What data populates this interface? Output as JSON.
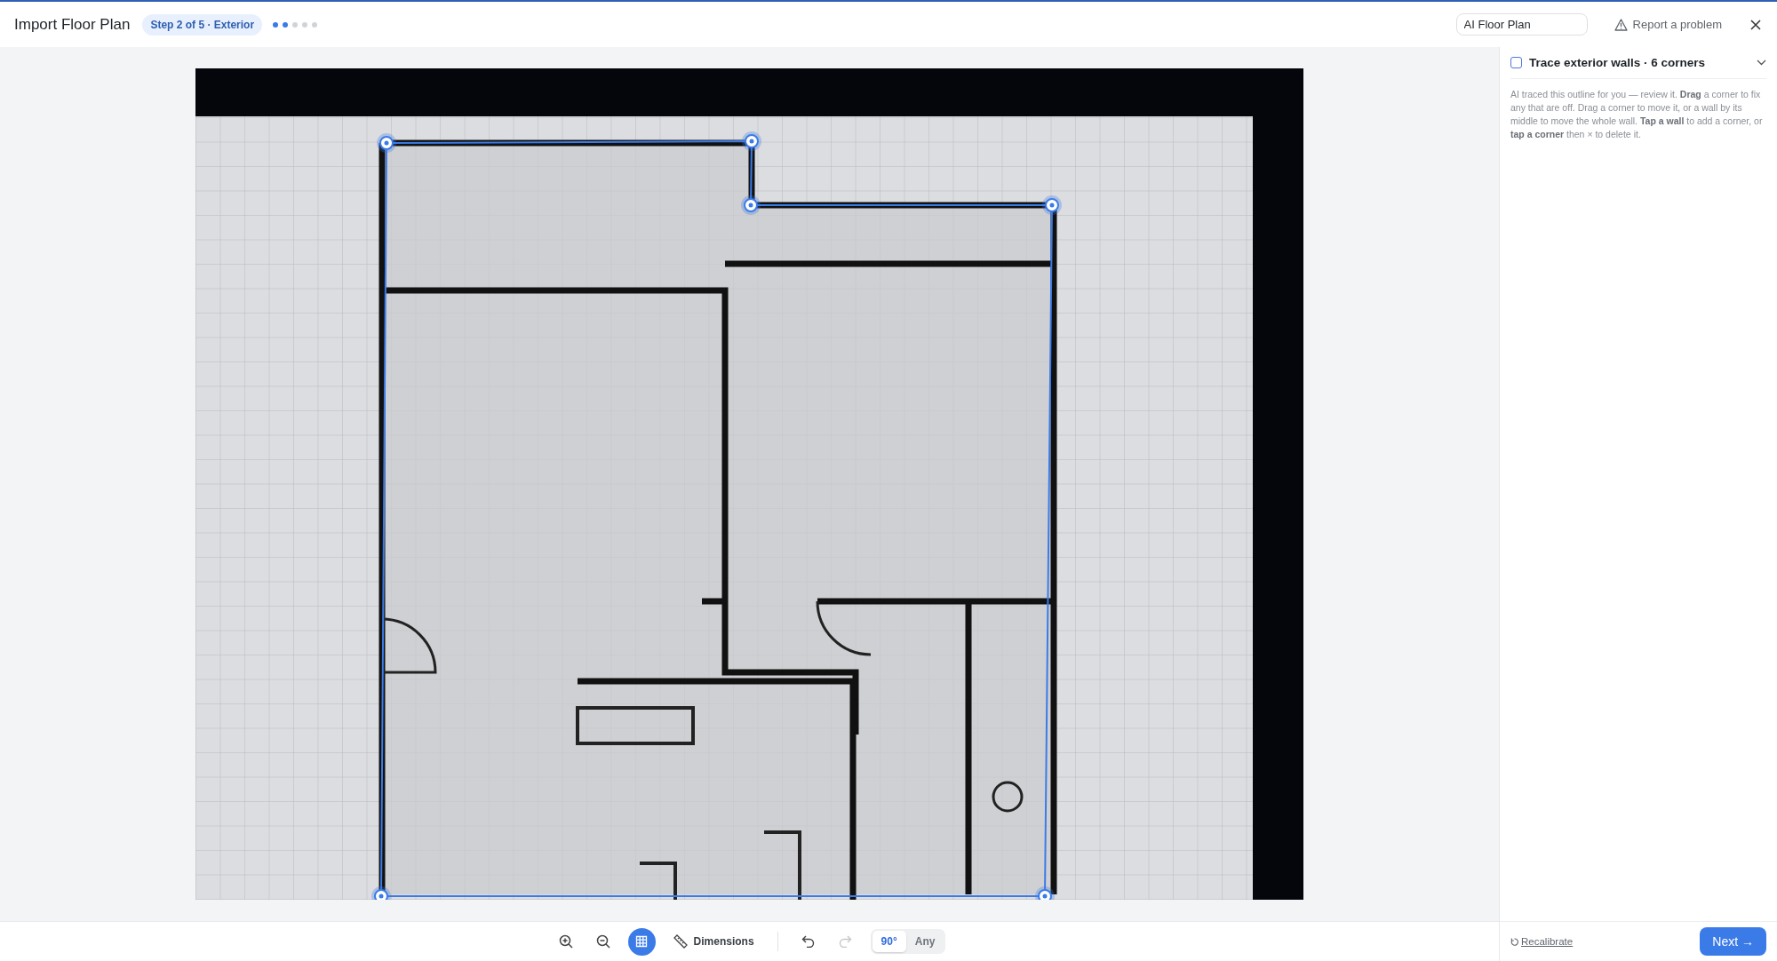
{
  "header": {
    "title": "Import Floor Plan",
    "step_badge": "Step 2 of 5 · Exterior",
    "progress_dots": [
      {
        "active": true
      },
      {
        "active": true
      },
      {
        "active": false
      },
      {
        "active": false
      },
      {
        "active": false
      }
    ],
    "name_field": {
      "value": "AI Floor Plan"
    },
    "report_link": "Report a problem"
  },
  "toolbar": {
    "grid": {
      "on": true
    },
    "dimensions": "Dimensions",
    "redo": {
      "disabled": true
    },
    "angle_options": [
      {
        "label": "90°",
        "selected": true
      },
      {
        "label": "Any",
        "selected": false
      }
    ]
  },
  "panel": {
    "task": {
      "title": "Trace exterior walls · 6 corners",
      "checked": false,
      "expanded": true,
      "help": "AI traced this outline for you — review it. **Drag** a corner to fix any that are off. Drag a corner to move it, or a wall by its middle to move the whole wall. **Tap a wall** to add a corner, or **tap a corner** then × to delete it."
    },
    "recalibrate": "Recalibrate",
    "next": "Next →"
  }
}
